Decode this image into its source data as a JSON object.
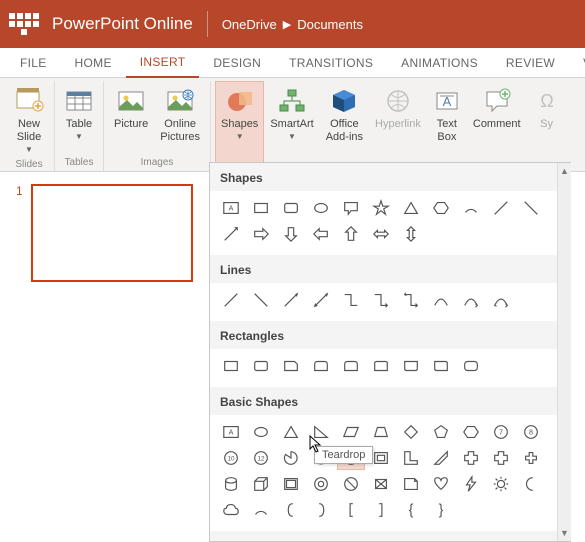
{
  "titleBar": {
    "appName": "PowerPoint Online",
    "breadcrumb": [
      "OneDrive",
      "Documents"
    ]
  },
  "tabs": [
    "FILE",
    "HOME",
    "INSERT",
    "DESIGN",
    "TRANSITIONS",
    "ANIMATIONS",
    "REVIEW",
    "VIEW"
  ],
  "activeTab": "INSERT",
  "ribbon": {
    "groups": [
      {
        "label": "Slides",
        "buttons": [
          {
            "id": "new-slide",
            "label": "New\nSlide",
            "caret": true
          }
        ]
      },
      {
        "label": "Tables",
        "buttons": [
          {
            "id": "table",
            "label": "Table",
            "caret": true
          }
        ]
      },
      {
        "label": "Images",
        "buttons": [
          {
            "id": "picture",
            "label": "Picture"
          },
          {
            "id": "online-pictures",
            "label": "Online\nPictures"
          }
        ]
      },
      {
        "label": "",
        "buttons": [
          {
            "id": "shapes",
            "label": "Shapes",
            "caret": true,
            "active": true
          },
          {
            "id": "smartart",
            "label": "SmartArt",
            "caret": true
          },
          {
            "id": "office-addins",
            "label": "Office\nAdd-ins"
          },
          {
            "id": "hyperlink",
            "label": "Hyperlink",
            "disabled": true
          },
          {
            "id": "text-box",
            "label": "Text\nBox"
          },
          {
            "id": "comment",
            "label": "Comment"
          },
          {
            "id": "symbol",
            "label": "Sy",
            "disabled": true
          }
        ]
      }
    ]
  },
  "slideNumber": "1",
  "gallery": {
    "sections": [
      {
        "title": "Shapes",
        "items": [
          "text-box",
          "rect",
          "round-rect",
          "oval",
          "speech",
          "star",
          "triangle",
          "hexagon",
          "arc",
          "line",
          "line2",
          "line3",
          "arrow-r",
          "arrow-d",
          "arrow-l",
          "arrow-u",
          "arrow-lr",
          "arrow-ud"
        ]
      },
      {
        "title": "Lines",
        "items": [
          "l1",
          "l2",
          "l3",
          "l4",
          "elbow1",
          "elbow2",
          "elbow3",
          "curve1",
          "elbow4",
          "elbow5"
        ]
      },
      {
        "title": "Rectangles",
        "items": [
          "r1",
          "r2",
          "r3",
          "r4",
          "r5",
          "r6",
          "r7",
          "r8",
          "r9"
        ]
      },
      {
        "title": "Basic Shapes",
        "items": [
          "bs-text",
          "bs-oval",
          "bs-tri",
          "bs-rtri",
          "bs-para",
          "bs-trap",
          "bs-diamond",
          "bs-pent",
          "bs-hex",
          "bs-7",
          "bs-8",
          "bs-10",
          "bs-12",
          "bs-pie",
          "bs-chord",
          "bs-teardrop",
          "bs-frame",
          "bs-l",
          "bs-diag",
          "bs-cross",
          "bs-plus",
          "bs-plus2",
          "bs-can",
          "bs-cube",
          "bs-bevel",
          "bs-donut",
          "bs-no",
          "bs-block",
          "bs-fold",
          "bs-heart",
          "bs-bolt",
          "bs-sun",
          "bs-moon",
          "bs-cloud",
          "bs-arc2",
          "bs-lb",
          "bs-rb",
          "bs-lb2",
          "bs-rb2",
          "bs-lcb",
          "bs-rcb"
        ]
      }
    ]
  },
  "tooltip": "Teardrop",
  "hoveredItem": "bs-teardrop"
}
